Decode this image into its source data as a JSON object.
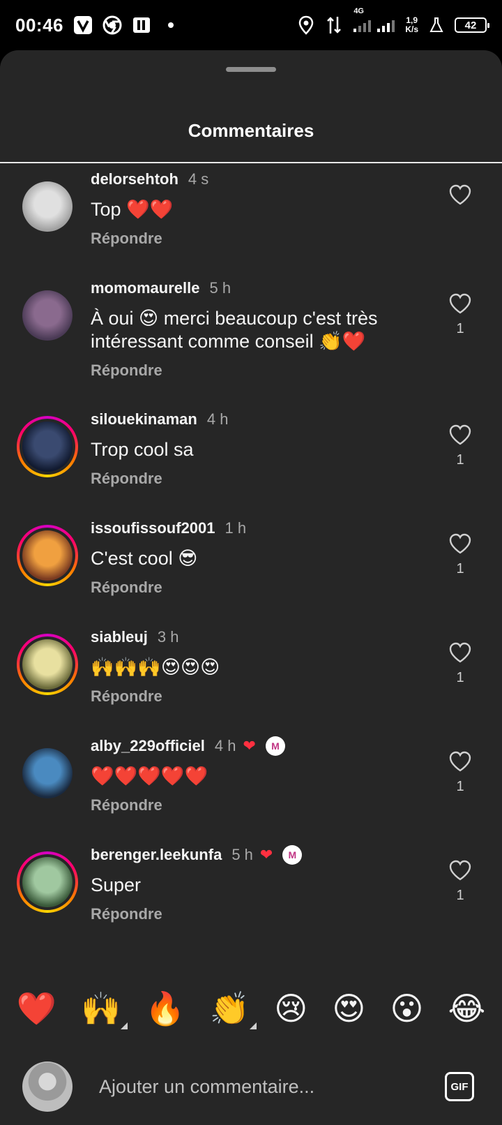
{
  "status_bar": {
    "time": "00:46",
    "network_type": "4G",
    "net_speed_value": "1,9",
    "net_speed_unit": "K/s",
    "battery": "42"
  },
  "sheet": {
    "title": "Commentaires"
  },
  "comments": [
    {
      "username": "delorsehtoh",
      "time": "4 s",
      "text": "Top ❤️❤️",
      "reply_label": "Répondre",
      "likes": "",
      "liked_by_creator": false,
      "creator_badge": false,
      "avatar_ring": false,
      "avatar_colors": [
        "#e0e0e0",
        "#a0a0a0"
      ]
    },
    {
      "username": "momomaurelle",
      "time": "5 h",
      "text": "À oui 😍 merci beaucoup c'est très intéressant comme conseil 👏❤️",
      "reply_label": "Répondre",
      "likes": "1",
      "liked_by_creator": false,
      "creator_badge": false,
      "avatar_ring": false,
      "avatar_colors": [
        "#8a6a8e",
        "#4a3a55"
      ]
    },
    {
      "username": "silouekinaman",
      "time": "4 h",
      "text": "Trop cool sa",
      "reply_label": "Répondre",
      "likes": "1",
      "liked_by_creator": false,
      "creator_badge": false,
      "avatar_ring": true,
      "avatar_colors": [
        "#3a4a70",
        "#111a30"
      ]
    },
    {
      "username": "issoufissouf2001",
      "time": "1 h",
      "text": "C'est cool 😎",
      "reply_label": "Répondre",
      "likes": "1",
      "liked_by_creator": false,
      "creator_badge": false,
      "avatar_ring": true,
      "avatar_colors": [
        "#f0a040",
        "#7a3a20"
      ]
    },
    {
      "username": "siableuj",
      "time": "3 h",
      "text": "🙌🙌🙌😍😍😍",
      "reply_label": "Répondre",
      "likes": "1",
      "liked_by_creator": false,
      "creator_badge": false,
      "avatar_ring": true,
      "avatar_colors": [
        "#e8e0a0",
        "#6a6a3a"
      ]
    },
    {
      "username": "alby_229officiel",
      "time": "4 h",
      "text": "❤️❤️❤️❤️❤️",
      "reply_label": "Répondre",
      "likes": "1",
      "liked_by_creator": true,
      "creator_badge": true,
      "avatar_ring": false,
      "avatar_colors": [
        "#4a8ac0",
        "#1a2a40"
      ]
    },
    {
      "username": "berenger.leekunfa",
      "time": "5 h",
      "text": "Super",
      "reply_label": "Répondre",
      "likes": "1",
      "liked_by_creator": true,
      "creator_badge": true,
      "avatar_ring": true,
      "avatar_colors": [
        "#a0c8a0",
        "#3a5a3a"
      ]
    }
  ],
  "quick_reactions": [
    {
      "emoji": "❤️",
      "more": false
    },
    {
      "emoji": "🙌",
      "more": true
    },
    {
      "emoji": "🔥",
      "more": false
    },
    {
      "emoji": "👏",
      "more": true
    },
    {
      "emoji": "😢",
      "more": false
    },
    {
      "emoji": "😍",
      "more": false
    },
    {
      "emoji": "😮",
      "more": false
    },
    {
      "emoji": "😂",
      "more": false
    }
  ],
  "composer": {
    "placeholder": "Ajouter un commentaire...",
    "gif_label": "GIF"
  },
  "colors": {
    "sheet_background": "#262626",
    "like_red": "#ff3040",
    "secondary_text": "#a8a8a8"
  }
}
